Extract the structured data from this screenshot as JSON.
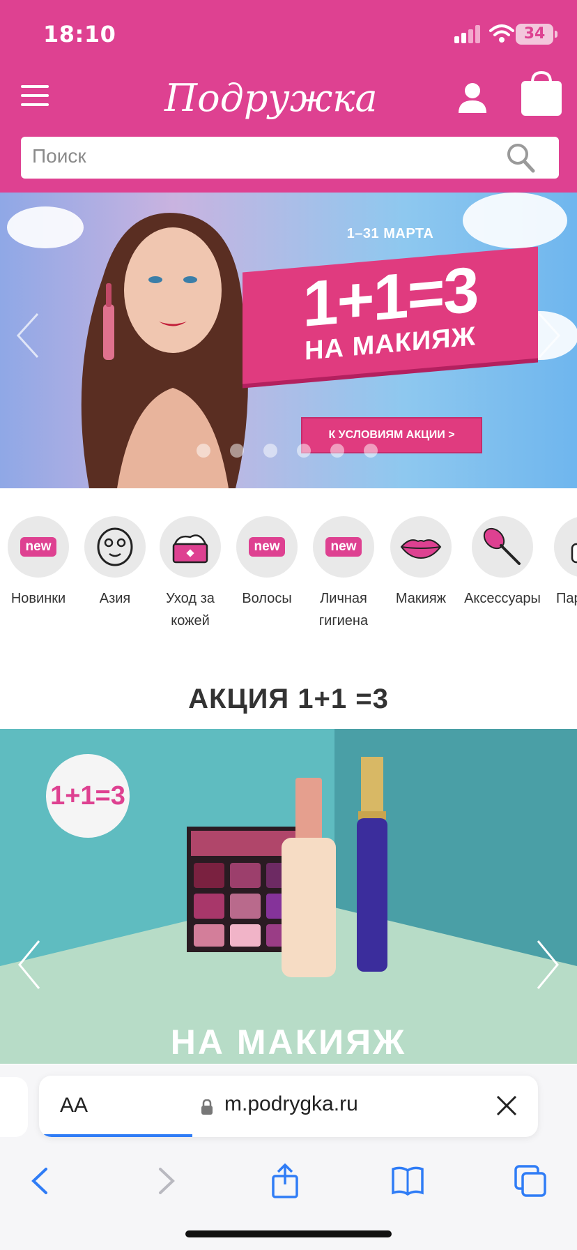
{
  "status_bar": {
    "time": "18:10",
    "battery": "34"
  },
  "header": {
    "logo": "Подружка"
  },
  "search": {
    "placeholder": "Поиск"
  },
  "banner": {
    "dates": "1–31 МАРТА",
    "headline": "1+1=3",
    "subheadline": "НА МАКИЯЖ",
    "cta": "К УСЛОВИЯМ АКЦИИ >",
    "slides_count": 6
  },
  "categories": [
    {
      "label": "Новинки",
      "icon": "new-badge-icon",
      "badge": "new"
    },
    {
      "label": "Азия",
      "icon": "face-mask-icon"
    },
    {
      "label": "Уход за кожей",
      "icon": "cream-jar-icon"
    },
    {
      "label": "Волосы",
      "icon": "new-badge-icon",
      "badge": "new"
    },
    {
      "label": "Личная гигиена",
      "icon": "new-badge-icon",
      "badge": "new"
    },
    {
      "label": "Макияж",
      "icon": "lips-icon"
    },
    {
      "label": "Аксессуары",
      "icon": "makeup-brush-icon"
    },
    {
      "label": "Пар",
      "icon": "perfume-icon"
    }
  ],
  "section": {
    "title": "АКЦИЯ 1+1 =3"
  },
  "promo": {
    "badge": "1+1=3",
    "headline": "НА МАКИЯЖ"
  },
  "safari": {
    "text_size": "AA",
    "url": "m.podrygka.ru"
  },
  "colors": {
    "brand": "#de4191",
    "promo_teal": "#5fbcc0",
    "link_blue": "#2f7cf6"
  }
}
